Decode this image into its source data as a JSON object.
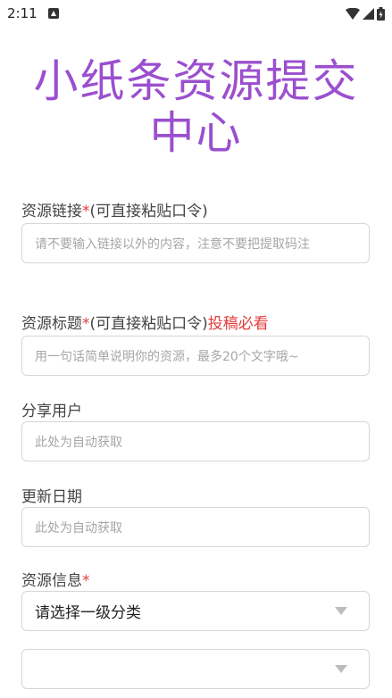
{
  "status_bar": {
    "time": "2:11",
    "icons": [
      "notification-icon",
      "wifi-icon",
      "signal-icon",
      "battery-icon"
    ]
  },
  "title": "小纸条资源提交中心",
  "title_line1": "小纸条资源提交",
  "title_line2": "中心",
  "colors": {
    "title": "#9b4fcf",
    "required": "#e33b3b",
    "border": "#d6d6d6",
    "placeholder": "#a6a6a6"
  },
  "form": {
    "link": {
      "label": "资源链接",
      "required_mark": "*",
      "label_suffix": "(可直接粘贴口令)",
      "placeholder": "请不要输入链接以外的内容，注意不要把提取码注"
    },
    "title": {
      "label": "资源标题",
      "required_mark": "*",
      "label_suffix": "(可直接粘贴口令)",
      "hint": "投稿必看",
      "placeholder": "用一句话简单说明你的资源，最多20个文字哦~"
    },
    "user": {
      "label": "分享用户",
      "placeholder": "此处为自动获取"
    },
    "date": {
      "label": "更新日期",
      "placeholder": "此处为自动获取"
    },
    "info": {
      "label": "资源信息",
      "required_mark": "*",
      "select1_value": "请选择一级分类",
      "select2_value": ""
    }
  }
}
